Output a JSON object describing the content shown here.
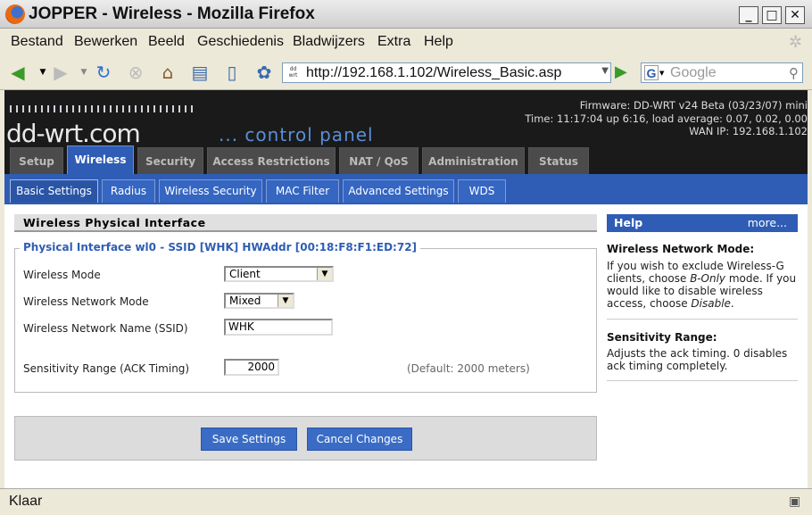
{
  "window": {
    "title": "JOPPER - Wireless - Mozilla Firefox",
    "min": "_",
    "max": "□",
    "close": "✕"
  },
  "menu": [
    "Bestand",
    "Bewerken",
    "Beeld",
    "Geschiedenis",
    "Bladwijzers",
    "Extra",
    "Help"
  ],
  "nav": {
    "url": "http://192.168.1.102/Wireless_Basic.asp",
    "search_placeholder": "Google",
    "favicon_text": "dd wrt"
  },
  "router": {
    "firmware": "Firmware: DD-WRT v24 Beta (03/23/07) mini",
    "time": "Time: 11:17:04 up 6:16, load average: 0.07, 0.02, 0.00",
    "wan": "WAN IP: 192.168.1.102",
    "logo": "dd-wrt.com",
    "tagline": "... control panel"
  },
  "tabs": [
    "Setup",
    "Wireless",
    "Security",
    "Access Restrictions",
    "NAT / QoS",
    "Administration",
    "Status"
  ],
  "subtabs": [
    "Basic Settings",
    "Radius",
    "Wireless Security",
    "MAC Filter",
    "Advanced Settings",
    "WDS"
  ],
  "section": {
    "title": "Wireless Physical Interface",
    "legend": "Physical Interface wl0 - SSID [WHK] HWAddr [00:18:F8:F1:ED:72]",
    "wireless_mode_label": "Wireless Mode",
    "wireless_mode_value": "Client",
    "network_mode_label": "Wireless Network Mode",
    "network_mode_value": "Mixed",
    "ssid_label": "Wireless Network Name (SSID)",
    "ssid_value": "WHK",
    "sens_label": "Sensitivity Range (ACK Timing)",
    "sens_value": "2000",
    "sens_default": "(Default: 2000 meters)"
  },
  "buttons": {
    "save": "Save Settings",
    "cancel": "Cancel Changes"
  },
  "help": {
    "title": "Help",
    "more": "more...",
    "h1": "Wireless Network Mode:",
    "t1a": "If you wish to exclude Wireless-G clients, choose ",
    "t1b": "B-Only",
    "t1c": " mode. If you would like to disable wireless access, choose ",
    "t1d": "Disable",
    "t1e": ".",
    "h2": "Sensitivity Range:",
    "t2": "Adjusts the ack timing. 0 disables ack timing completely."
  },
  "status": "Klaar"
}
